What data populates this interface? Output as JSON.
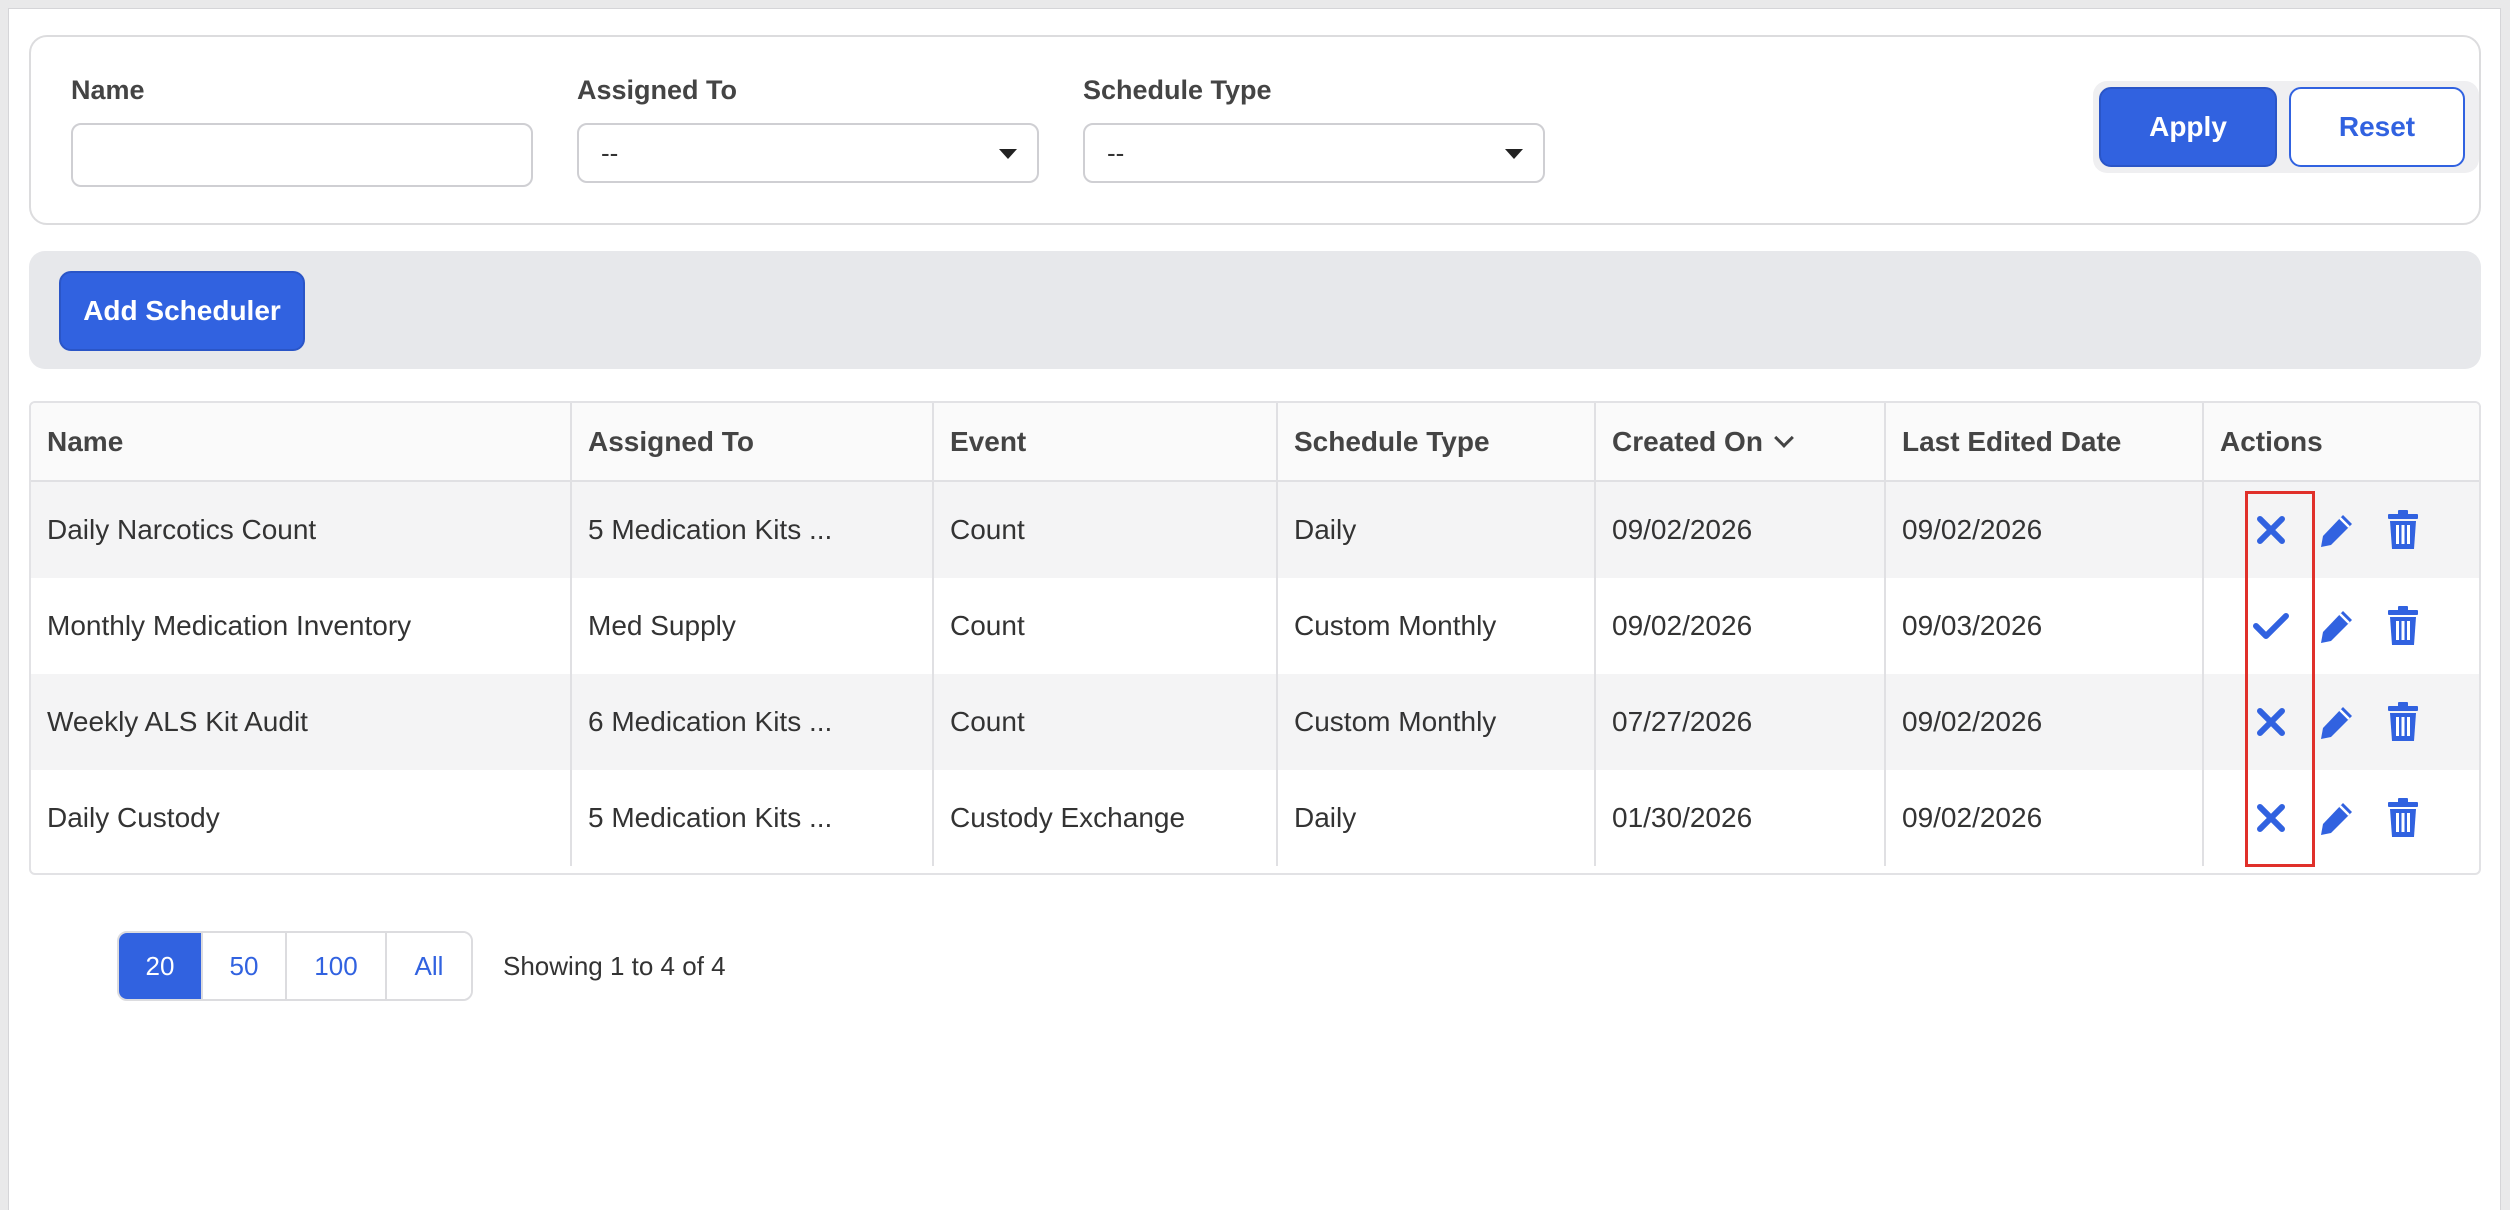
{
  "filters": {
    "name_label": "Name",
    "name_value": "",
    "assigned_label": "Assigned To",
    "assigned_value": "--",
    "schedule_label": "Schedule Type",
    "schedule_value": "--",
    "apply_label": "Apply",
    "reset_label": "Reset"
  },
  "toolbar": {
    "add_label": "Add Scheduler"
  },
  "table": {
    "headers": {
      "name": "Name",
      "assigned": "Assigned To",
      "event": "Event",
      "schedule": "Schedule Type",
      "created": "Created On",
      "edited": "Last Edited Date",
      "actions": "Actions"
    },
    "rows": [
      {
        "name": "Daily Narcotics Count",
        "assigned": "5 Medication Kits ...",
        "event": "Count",
        "schedule": "Daily",
        "created": "09/02/2026",
        "edited": "09/02/2026",
        "status_icon": "x-icon"
      },
      {
        "name": "Monthly Medication Inventory",
        "assigned": "Med Supply",
        "event": "Count",
        "schedule": "Custom Monthly",
        "created": "09/02/2026",
        "edited": "09/03/2026",
        "status_icon": "check-icon"
      },
      {
        "name": "Weekly ALS Kit Audit",
        "assigned": "6 Medication Kits ...",
        "event": "Count",
        "schedule": "Custom Monthly",
        "created": "07/27/2026",
        "edited": "09/02/2026",
        "status_icon": "x-icon"
      },
      {
        "name": "Daily Custody",
        "assigned": "5 Medication Kits ...",
        "event": "Custody Exchange",
        "schedule": "Daily",
        "created": "01/30/2026",
        "edited": "09/02/2026",
        "status_icon": "x-icon"
      }
    ]
  },
  "pagination": {
    "sizes": [
      "20",
      "50",
      "100",
      "All"
    ],
    "active": "20",
    "showing": "Showing 1 to 4 of 4"
  },
  "colors": {
    "accent": "#3162e0",
    "highlight": "#e0302a"
  }
}
